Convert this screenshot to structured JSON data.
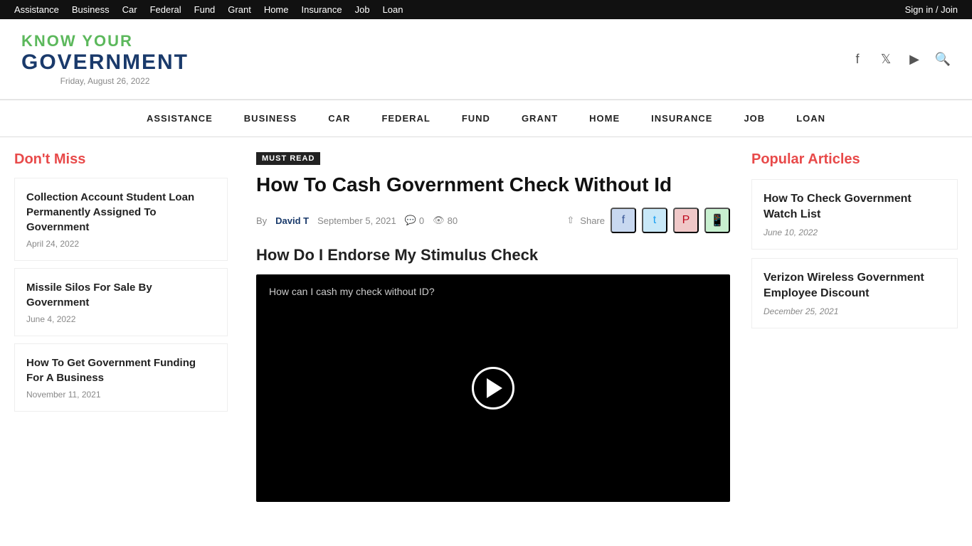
{
  "topbar": {
    "nav_items": [
      "Assistance",
      "Business",
      "Car",
      "Federal",
      "Fund",
      "Grant",
      "Home",
      "Insurance",
      "Job",
      "Loan"
    ],
    "signin_label": "Sign in / Join"
  },
  "header": {
    "logo_know": "KNOW YOUR",
    "logo_gov": "GOVERNMENT",
    "date": "Friday, August 26, 2022",
    "icons": [
      "facebook-icon",
      "twitter-icon",
      "youtube-icon",
      "search-icon"
    ]
  },
  "mainnav": {
    "items": [
      "ASSISTANCE",
      "BUSINESS",
      "CAR",
      "FEDERAL",
      "FUND",
      "GRANT",
      "HOME",
      "INSURANCE",
      "JOB",
      "LOAN"
    ]
  },
  "sidebar_left": {
    "title": "Don't Miss",
    "cards": [
      {
        "title": "Collection Account Student Loan Permanently Assigned To Government",
        "date": "April 24, 2022"
      },
      {
        "title": "Missile Silos For Sale By Government",
        "date": "June 4, 2022"
      },
      {
        "title": "How To Get Government Funding For A Business",
        "date": "November 11, 2021"
      }
    ]
  },
  "article": {
    "badge": "MUST READ",
    "title": "How To Cash Government Check Without Id",
    "by": "By",
    "author": "David T",
    "date": "September 5, 2021",
    "comments_count": "0",
    "views_count": "80",
    "share_label": "Share",
    "video_section_title": "How Do I Endorse My Stimulus Check",
    "video_caption": "How can I cash my check without ID?"
  },
  "sidebar_right": {
    "title": "Popular Articles",
    "articles": [
      {
        "title": "How To Check Government Watch List",
        "date": "June 10, 2022"
      },
      {
        "title": "Verizon Wireless Government Employee Discount",
        "date": "December 25, 2021"
      }
    ]
  }
}
